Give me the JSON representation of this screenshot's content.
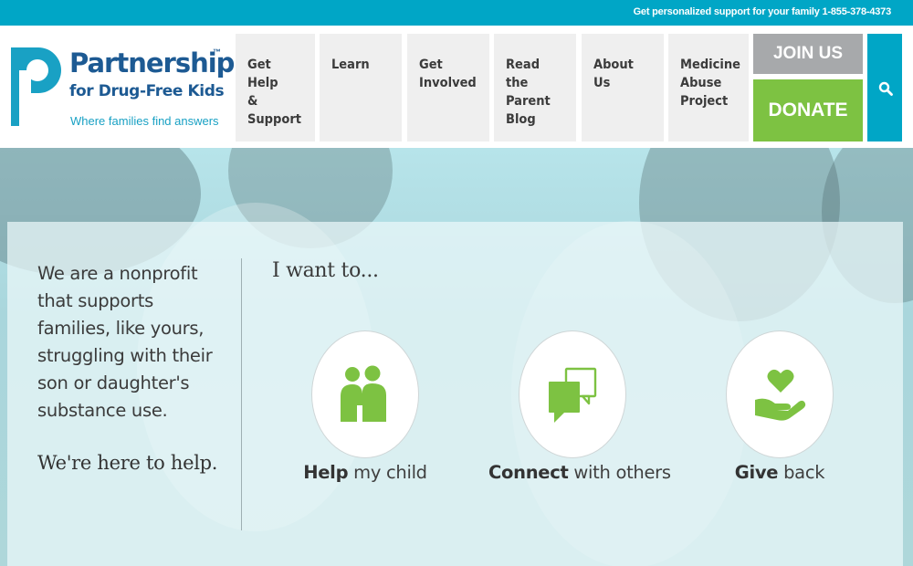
{
  "topbar": {
    "support_text": "Get personalized support for your family 1-855-378-4373"
  },
  "logo": {
    "brand": "Partnership",
    "tm": "™",
    "sub": "for Drug-Free Kids",
    "tagline": "Where families find answers"
  },
  "nav": {
    "items": [
      {
        "label": "Get Help\n&\nSupport"
      },
      {
        "label": "Learn"
      },
      {
        "label": "Get\nInvolved"
      },
      {
        "label": "Read the\nParent\nBlog"
      },
      {
        "label": "About Us"
      },
      {
        "label": "Medicine\nAbuse\nProject"
      }
    ],
    "join_label": "JOIN US",
    "donate_label": "DONATE"
  },
  "hero": {
    "intro": "We are a nonprofit that supports families, like yours, struggling with their son or daughter's substance use.",
    "here": "We're here to help.",
    "want": "I want to...",
    "options": [
      {
        "bold": "Help",
        "rest": " my child",
        "icon": "family-icon"
      },
      {
        "bold": "Connect",
        "rest": " with others",
        "icon": "chat-icon"
      },
      {
        "bold": "Give",
        "rest": " back",
        "icon": "heart-hand-icon"
      }
    ]
  },
  "colors": {
    "teal": "#00a6c6",
    "navy": "#1d5a93",
    "green": "#7dc242",
    "gray": "#a7a9ab"
  }
}
